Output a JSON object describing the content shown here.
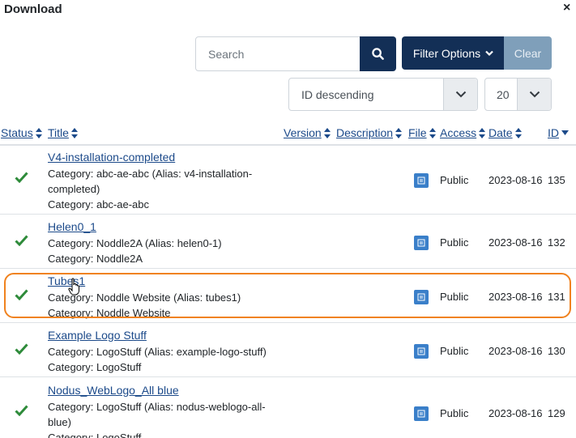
{
  "dialog": {
    "title": "Download",
    "close_glyph": "×"
  },
  "search": {
    "placeholder": "Search",
    "icon": "search-icon"
  },
  "filter": {
    "label": "Filter Options",
    "icon": "chevron-down-icon",
    "clear_label": "Clear"
  },
  "sort": {
    "selected": "ID descending"
  },
  "limit": {
    "selected": "20"
  },
  "columns": [
    "Status",
    "Title",
    "Version",
    "Description",
    "File",
    "Access",
    "Date",
    "ID"
  ],
  "rows": [
    {
      "status": "check-icon",
      "title": "V4-installation-completed",
      "category_line": "Category: abc-ae-abc (Alias: v4-installation-completed)",
      "category": "Category: abc-ae-abc",
      "file": "file-icon",
      "access": "Public",
      "date": "2023-08-16",
      "id": "135"
    },
    {
      "status": "check-icon",
      "title": "Helen0_1",
      "category_line": "Category: Noddle2A (Alias: helen0-1)",
      "category": "Category: Noddle2A",
      "file": "file-icon",
      "access": "Public",
      "date": "2023-08-16",
      "id": "132"
    },
    {
      "status": "check-icon",
      "title": "Tubes1",
      "category_line": "Category: Noddle Website (Alias: tubes1)",
      "category": "Category: Noddle Website",
      "file": "file-icon",
      "access": "Public",
      "date": "2023-08-16",
      "id": "131"
    },
    {
      "status": "check-icon",
      "title": "Example Logo Stuff",
      "category_line": "Category: LogoStuff (Alias: example-logo-stuff)",
      "category": "Category: LogoStuff",
      "file": "file-icon",
      "access": "Public",
      "date": "2023-08-16",
      "id": "130"
    },
    {
      "status": "check-icon",
      "title": "Nodus_WebLogo_All blue",
      "category_line": "Category: LogoStuff (Alias: nodus-weblogo-all-blue)",
      "category": "Category: LogoStuff",
      "file": "file-icon",
      "access": "Public",
      "date": "2023-08-16",
      "id": "129"
    }
  ],
  "colors": {
    "primary": "#132f56",
    "clear": "#7f9fba",
    "link": "#1c4a8a",
    "check": "#2e8b3a",
    "highlight": "#f0821e",
    "file": "#3a7fc9"
  }
}
